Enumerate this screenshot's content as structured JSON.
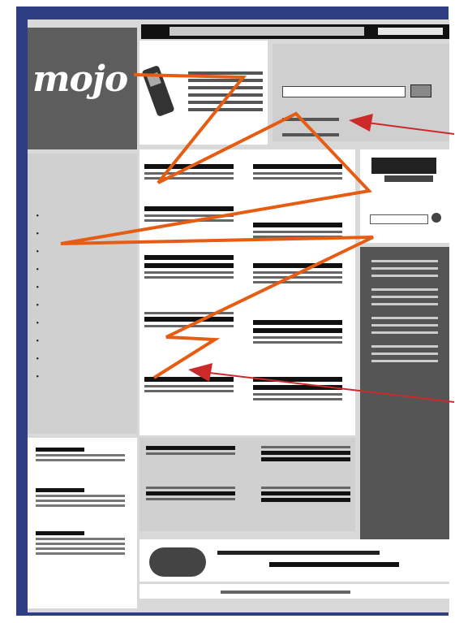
{
  "logo": {
    "text": "mojo"
  },
  "colors": {
    "frame": "#2f3d83",
    "zigzag": "#e65c12",
    "arrow": "#cc2a2a"
  },
  "icons": [
    "phone-icon",
    "arrow-icon"
  ]
}
